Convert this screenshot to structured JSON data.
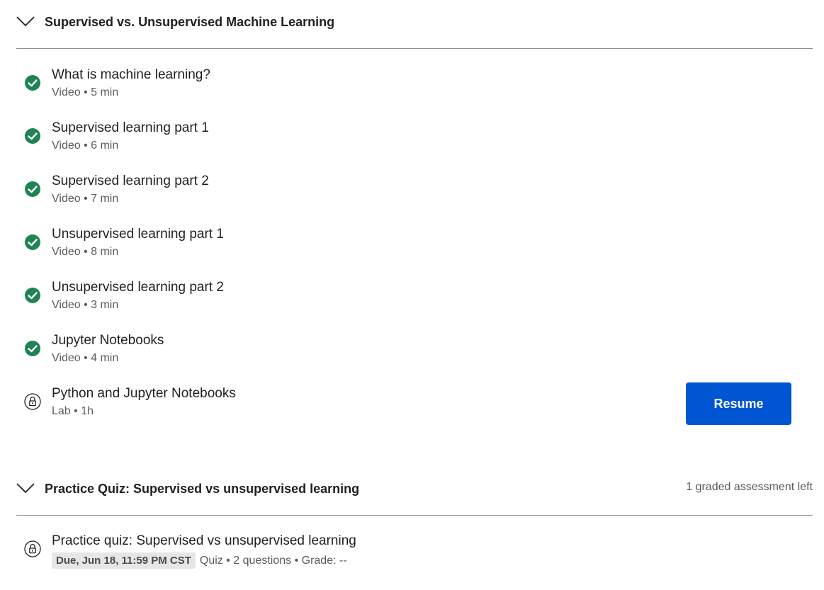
{
  "sections": [
    {
      "title": "Supervised vs. Unsupervised Machine Learning",
      "meta": "",
      "items": [
        {
          "title": "What is machine learning?",
          "meta": "Video • 5 min",
          "status": "completed"
        },
        {
          "title": "Supervised learning part 1",
          "meta": "Video • 6 min",
          "status": "completed"
        },
        {
          "title": "Supervised learning part 2",
          "meta": "Video • 7 min",
          "status": "completed"
        },
        {
          "title": "Unsupervised learning part 1",
          "meta": "Video • 8 min",
          "status": "completed"
        },
        {
          "title": "Unsupervised learning part 2",
          "meta": "Video • 3 min",
          "status": "completed"
        },
        {
          "title": "Jupyter Notebooks",
          "meta": "Video • 4 min",
          "status": "completed"
        },
        {
          "title": "Python and Jupyter Notebooks",
          "meta": "Lab • 1h",
          "status": "locked"
        }
      ]
    },
    {
      "title": "Practice Quiz: Supervised vs unsupervised learning",
      "meta": "1 graded assessment left",
      "items": [
        {
          "title": "Practice quiz: Supervised vs unsupervised learning",
          "due": "Due, Jun 18, 11:59 PM CST",
          "meta": "Quiz • 2 questions • Grade: --",
          "status": "locked"
        }
      ]
    }
  ],
  "resume_button": "Resume",
  "colors": {
    "completed": "#1f8354",
    "primary_button": "#0056d2",
    "divider": "#8f8f8f",
    "secondary_text": "#5b5b5b"
  },
  "icons": {
    "collapse": "chevron-down-icon",
    "completed": "check-circle-icon",
    "locked": "lock-icon"
  }
}
